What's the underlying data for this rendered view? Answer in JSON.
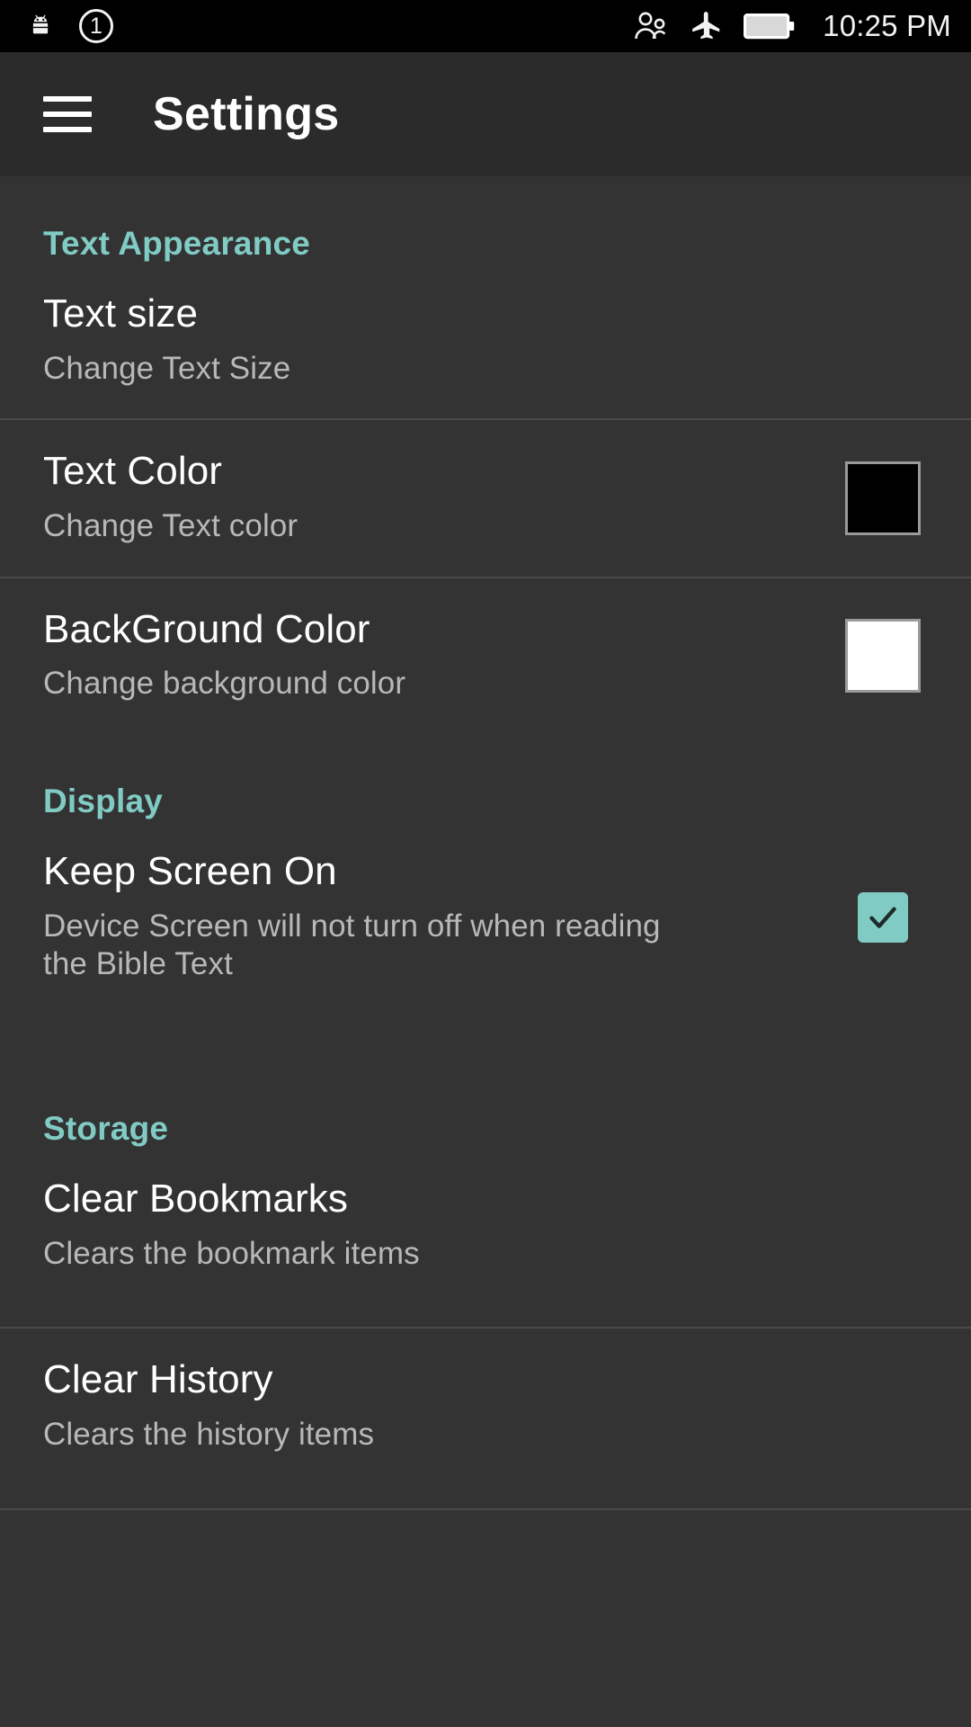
{
  "status_bar": {
    "left_icons": [
      {
        "name": "android-debug-icon",
        "label": "android"
      },
      {
        "name": "notification-count-badge",
        "label": "1"
      }
    ],
    "right_icons": [
      {
        "name": "users-icon",
        "label": "users"
      },
      {
        "name": "airplane-mode-icon",
        "label": "airplane mode"
      },
      {
        "name": "battery-full-icon",
        "label": "battery full"
      }
    ],
    "time": "10:25 PM"
  },
  "app_bar": {
    "menu_icon": "hamburger-menu-icon",
    "title": "Settings"
  },
  "colors": {
    "accent": "#80CBC4",
    "background": "#333333",
    "app_bar": "#2B2B2B",
    "status_bar": "#000000",
    "title_text": "#FFFFFF",
    "subtitle_text": "#B8B8B8",
    "divider": "#4A4A4A"
  },
  "sections": [
    {
      "header": "Text Appearance",
      "rows": [
        {
          "title": "Text size",
          "subtitle": "Change Text Size",
          "accessory": "none"
        },
        {
          "title": "Text Color",
          "subtitle": "Change Text color",
          "accessory": "color-swatch",
          "swatch_color": "#000000"
        },
        {
          "title": "BackGround Color",
          "subtitle": "Change background color",
          "accessory": "color-swatch",
          "swatch_color": "#FFFFFF"
        }
      ]
    },
    {
      "header": "Display",
      "rows": [
        {
          "title": "Keep Screen On",
          "subtitle": "Device Screen will not turn off when reading the Bible Text",
          "accessory": "checkbox",
          "checked": true
        }
      ]
    },
    {
      "header": "Storage",
      "rows": [
        {
          "title": "Clear Bookmarks",
          "subtitle": "Clears the bookmark items",
          "accessory": "none"
        },
        {
          "title": "Clear History",
          "subtitle": "Clears the history items",
          "accessory": "none"
        }
      ]
    }
  ]
}
